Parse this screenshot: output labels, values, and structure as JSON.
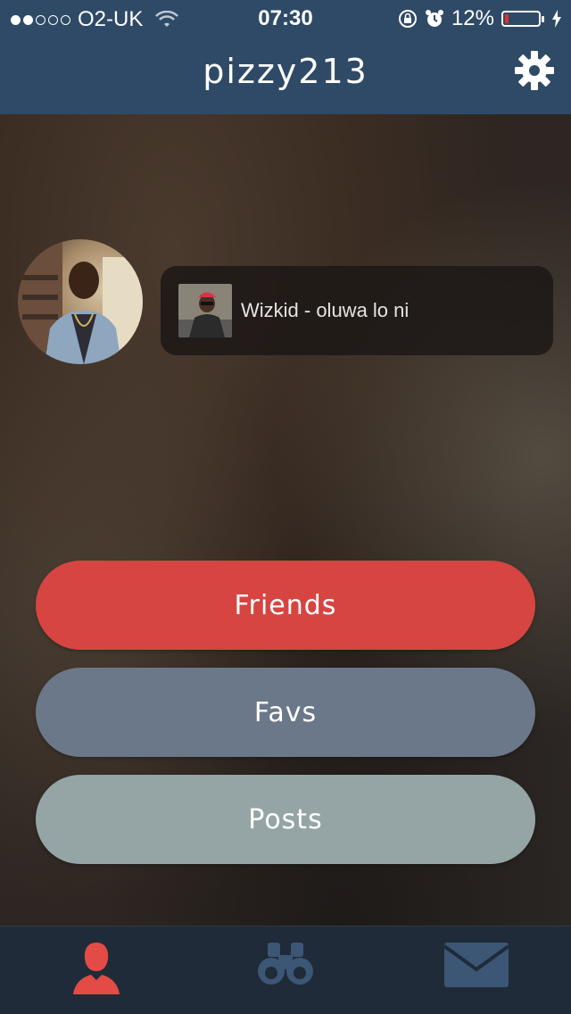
{
  "status_bar": {
    "carrier": "O2-UK",
    "time": "07:30",
    "battery_percent": "12%",
    "battery_level": 0.12
  },
  "nav": {
    "title": "pizzy213"
  },
  "now_playing": {
    "track": "Wizkid - oluwa lo ni"
  },
  "buttons": [
    {
      "label": "Friends",
      "color": "#d64541"
    },
    {
      "label": "Favs",
      "color": "#6a7889"
    },
    {
      "label": "Posts",
      "color": "#95a5a6"
    }
  ],
  "tabs": [
    {
      "icon": "person-icon",
      "active": true,
      "color": "#e34b46"
    },
    {
      "icon": "binoculars-icon",
      "active": false,
      "color": "#3c5675"
    },
    {
      "icon": "mail-icon",
      "active": false,
      "color": "#3c5675"
    }
  ],
  "colors": {
    "header": "#2f4a66",
    "tab_bar": "#1f2b38"
  }
}
